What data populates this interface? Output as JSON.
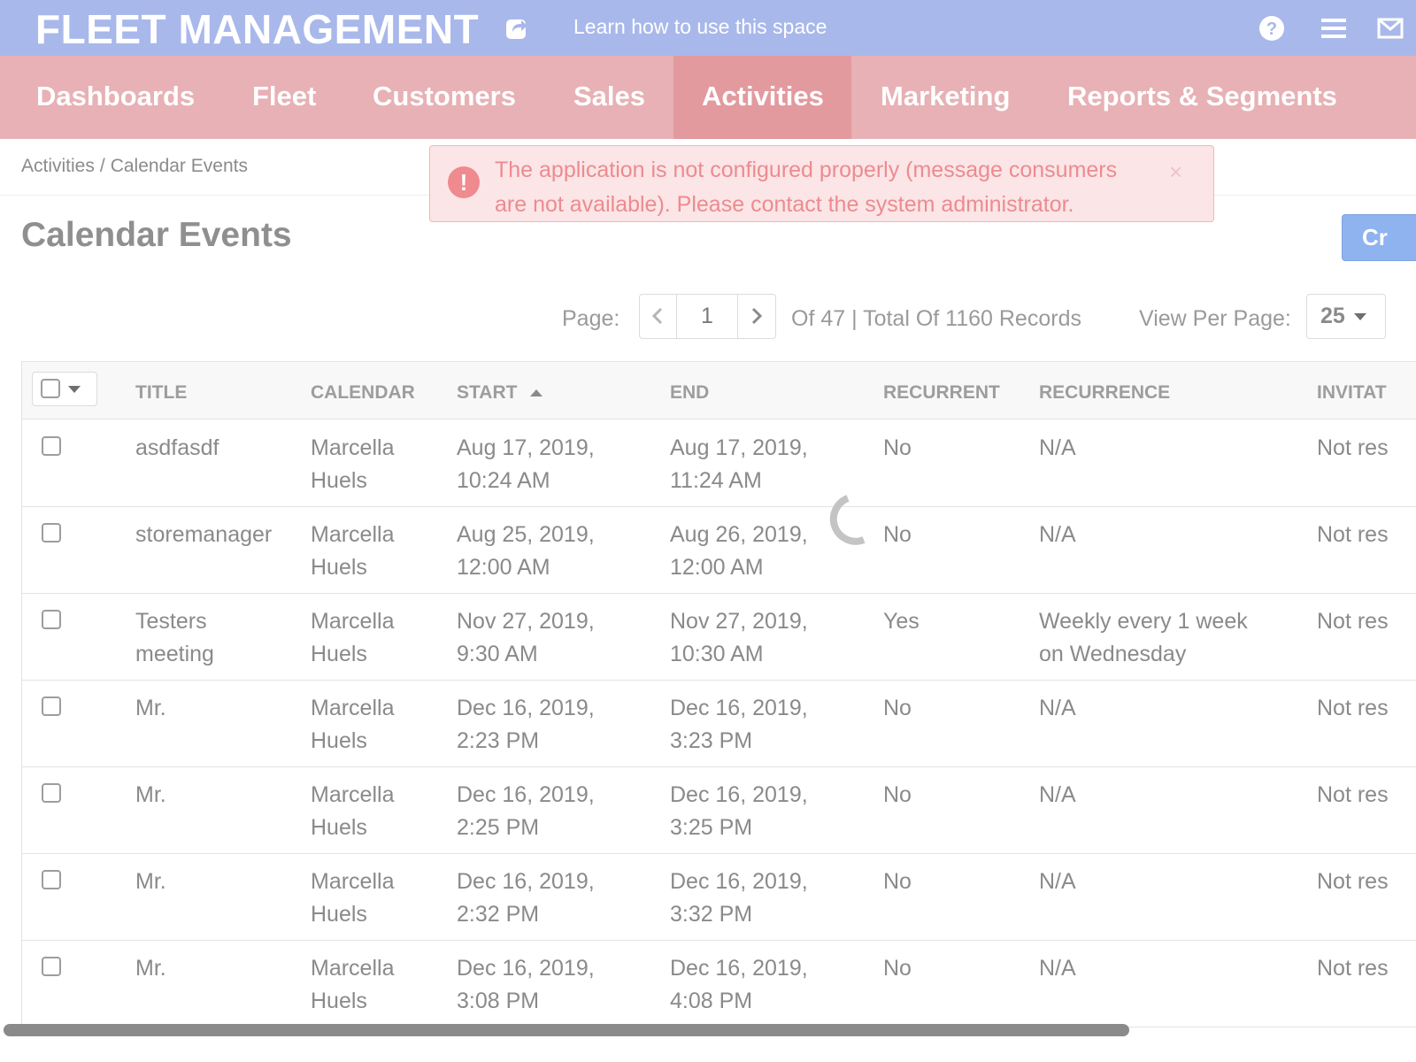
{
  "topbar": {
    "app_title": "FLEET MANAGEMENT",
    "learn_link": "Learn how to use this space",
    "icons": [
      "share-icon",
      "help-icon",
      "menu-icon",
      "mail-icon"
    ]
  },
  "nav": {
    "items": [
      {
        "label": "Dashboards"
      },
      {
        "label": "Fleet"
      },
      {
        "label": "Customers"
      },
      {
        "label": "Sales"
      },
      {
        "label": "Activities"
      },
      {
        "label": "Marketing"
      },
      {
        "label": "Reports & Segments"
      }
    ],
    "active": "Activities"
  },
  "breadcrumb": {
    "parent": "Activities",
    "separator": "/",
    "current": "Calendar Events"
  },
  "alert": {
    "text": "The application is not configured properly (message consumers are not available). Please contact the system administrator.",
    "close": "×",
    "icon": "!"
  },
  "page": {
    "title": "Calendar Events",
    "create_button": "Cr"
  },
  "pagination": {
    "label": "Page:",
    "current_page": "1",
    "total": "Of 47 | Total Of 1160 Records",
    "per_page_label": "View Per Page:",
    "per_page": "25"
  },
  "grid": {
    "columns": [
      "TITLE",
      "CALENDAR",
      "START",
      "END",
      "RECURRENT",
      "RECURRENCE",
      "INVITAT"
    ],
    "sorted_column": "START",
    "rows": [
      {
        "title": [
          "asdfasdf",
          ""
        ],
        "calendar": [
          "Marcella",
          "Huels"
        ],
        "start": [
          "Aug 17, 2019,",
          "10:24 AM"
        ],
        "end": [
          "Aug 17, 2019,",
          "11:24 AM"
        ],
        "recurrent": "No",
        "recurrence": [
          "N/A",
          ""
        ],
        "invitation": "Not res"
      },
      {
        "title": [
          "storemanager",
          ""
        ],
        "calendar": [
          "Marcella",
          "Huels"
        ],
        "start": [
          "Aug 25, 2019,",
          "12:00 AM"
        ],
        "end": [
          "Aug 26, 2019,",
          "12:00 AM"
        ],
        "recurrent": "No",
        "recurrence": [
          "N/A",
          ""
        ],
        "invitation": "Not res"
      },
      {
        "title": [
          "Testers",
          "meeting"
        ],
        "calendar": [
          "Marcella",
          "Huels"
        ],
        "start": [
          "Nov 27, 2019,",
          "9:30 AM"
        ],
        "end": [
          "Nov 27, 2019,",
          "10:30 AM"
        ],
        "recurrent": "Yes",
        "recurrence": [
          "Weekly every 1 week",
          "on Wednesday"
        ],
        "invitation": "Not res"
      },
      {
        "title": [
          "Mr.",
          ""
        ],
        "calendar": [
          "Marcella",
          "Huels"
        ],
        "start": [
          "Dec 16, 2019,",
          "2:23 PM"
        ],
        "end": [
          "Dec 16, 2019,",
          "3:23 PM"
        ],
        "recurrent": "No",
        "recurrence": [
          "N/A",
          ""
        ],
        "invitation": "Not res"
      },
      {
        "title": [
          "Mr.",
          ""
        ],
        "calendar": [
          "Marcella",
          "Huels"
        ],
        "start": [
          "Dec 16, 2019,",
          "2:25 PM"
        ],
        "end": [
          "Dec 16, 2019,",
          "3:25 PM"
        ],
        "recurrent": "No",
        "recurrence": [
          "N/A",
          ""
        ],
        "invitation": "Not res"
      },
      {
        "title": [
          "Mr.",
          ""
        ],
        "calendar": [
          "Marcella",
          "Huels"
        ],
        "start": [
          "Dec 16, 2019,",
          "2:32 PM"
        ],
        "end": [
          "Dec 16, 2019,",
          "3:32 PM"
        ],
        "recurrent": "No",
        "recurrence": [
          "N/A",
          ""
        ],
        "invitation": "Not res"
      },
      {
        "title": [
          "Mr.",
          ""
        ],
        "calendar": [
          "Marcella",
          "Huels"
        ],
        "start": [
          "Dec 16, 2019,",
          "3:08 PM"
        ],
        "end": [
          "Dec 16, 2019,",
          "4:08 PM"
        ],
        "recurrent": "No",
        "recurrence": [
          "N/A",
          ""
        ],
        "invitation": "Not res"
      }
    ]
  },
  "colors": {
    "topbar": "#a9b8ea",
    "navbar": "#e7b1b5",
    "nav_active": "#e29a9e",
    "alert_bg": "#fbe5e6",
    "alert_text": "#ec8b90",
    "primary_button": "#8fb3ef"
  }
}
